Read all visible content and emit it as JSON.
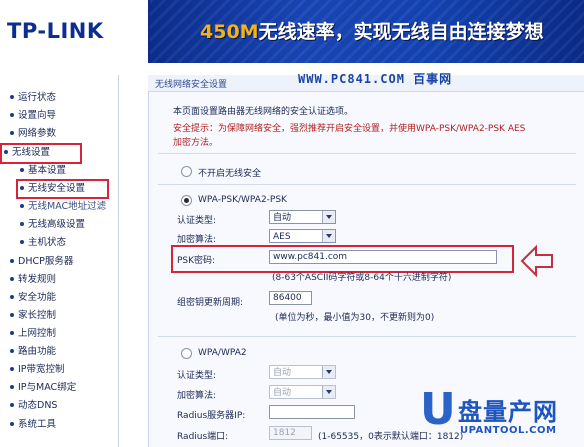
{
  "header": {
    "logo": "TP-LINK",
    "banner_highlight": "450M",
    "banner_text": "无线速率，实现无线自由连接梦想"
  },
  "sidebar": {
    "items": [
      {
        "label": "运行状态"
      },
      {
        "label": "设置向导"
      },
      {
        "label": "网络参数"
      },
      {
        "label": "无线设置"
      },
      {
        "label": "基本设置"
      },
      {
        "label": "无线安全设置"
      },
      {
        "label": "无线MAC地址过滤"
      },
      {
        "label": "无线高级设置"
      },
      {
        "label": "主机状态"
      },
      {
        "label": "DHCP服务器"
      },
      {
        "label": "转发规则"
      },
      {
        "label": "安全功能"
      },
      {
        "label": "家长控制"
      },
      {
        "label": "上网控制"
      },
      {
        "label": "路由功能"
      },
      {
        "label": "IP带宽控制"
      },
      {
        "label": "IP与MAC绑定"
      },
      {
        "label": "动态DNS"
      },
      {
        "label": "系统工具"
      }
    ]
  },
  "panel": {
    "title": "无线网络安全设置",
    "watermark": "WWW.PC841.COM 百事网",
    "intro": "本页面设置路由器无线网络的安全认证选项。",
    "warning_line1": "安全提示：为保障网络安全，强烈推荐开启安全设置，并使用WPA-PSK/WPA2-PSK AES",
    "warning_line2": "加密方法。",
    "option_none": "不开启无线安全",
    "option_wpa_psk": "WPA-PSK/WPA2-PSK",
    "auth_label": "认证类型:",
    "auth_value": "自动",
    "enc_label": "加密算法:",
    "enc_value": "AES",
    "psk_label": "PSK密码:",
    "psk_value": "www.pc841.com",
    "psk_hint": "(8-63个ASCII码字符或8-64个十六进制字符)",
    "group_key_label": "组密钥更新周期:",
    "group_key_value": "86400",
    "group_key_hint": "(单位为秒，最小值为30，不更新则为0)",
    "option_wpa": "WPA/WPA2",
    "auth2_label": "认证类型:",
    "auth2_value": "自动",
    "enc2_label": "加密算法:",
    "enc2_value": "自动",
    "radius_ip_label": "Radius服务器IP:",
    "radius_ip_value": "",
    "radius_port_label": "Radius端口:",
    "radius_port_value": "1812",
    "radius_port_hint": "(1-65535，0表示默认端口：1812)"
  },
  "brand": {
    "mark": "U",
    "name": "盘量产网",
    "url": "UPANTOOL.COM"
  }
}
